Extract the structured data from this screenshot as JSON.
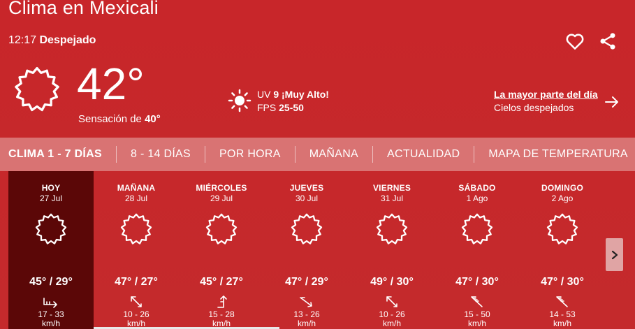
{
  "header": {
    "title": "Clima en Mexicali",
    "time": "12:17",
    "condition": "Despejado"
  },
  "current": {
    "temp": "42°",
    "feels_label": "Sensación de",
    "feels_value": "40°",
    "uv_label": "UV",
    "uv_value": "9 ¡Muy Alto!",
    "fps_label": "FPS",
    "fps_value": "25-50",
    "forecast_link": "La mayor parte del día",
    "forecast_text": "Cielos despejados"
  },
  "tabs": [
    {
      "label": "CLIMA 1 - 7 DÍAS"
    },
    {
      "label": "8 - 14 DÍAS"
    },
    {
      "label": "POR HORA"
    },
    {
      "label": "MAÑANA"
    },
    {
      "label": "ACTUALIDAD"
    },
    {
      "label": "MAPA DE TEMPERATURA"
    }
  ],
  "days": [
    {
      "name": "HOY",
      "date": "27 Jul",
      "temps": "45° / 29°",
      "wind": "17 - 33",
      "unit": "km/h"
    },
    {
      "name": "MAÑANA",
      "date": "28 Jul",
      "temps": "47° / 27°",
      "wind": "10 - 26",
      "unit": "km/h"
    },
    {
      "name": "MIÉRCOLES",
      "date": "29 Jul",
      "temps": "45° / 27°",
      "wind": "15 - 28",
      "unit": "km/h"
    },
    {
      "name": "JUEVES",
      "date": "30 Jul",
      "temps": "47° / 29°",
      "wind": "13 - 26",
      "unit": "km/h"
    },
    {
      "name": "VIERNES",
      "date": "31 Jul",
      "temps": "49° / 30°",
      "wind": "10 - 26",
      "unit": "km/h"
    },
    {
      "name": "SÁBADO",
      "date": "1 Ago",
      "temps": "47° / 30°",
      "wind": "15 - 50",
      "unit": "km/h"
    },
    {
      "name": "DOMINGO",
      "date": "2 Ago",
      "temps": "47° / 30°",
      "wind": "14 - 53",
      "unit": "km/h"
    }
  ],
  "icons": {
    "sun": "sun-icon",
    "heart": "heart-icon",
    "share": "share-icon",
    "arrow": "arrow-right-icon",
    "wind": "wind-direction-icon",
    "next": "chevron-right-icon"
  }
}
